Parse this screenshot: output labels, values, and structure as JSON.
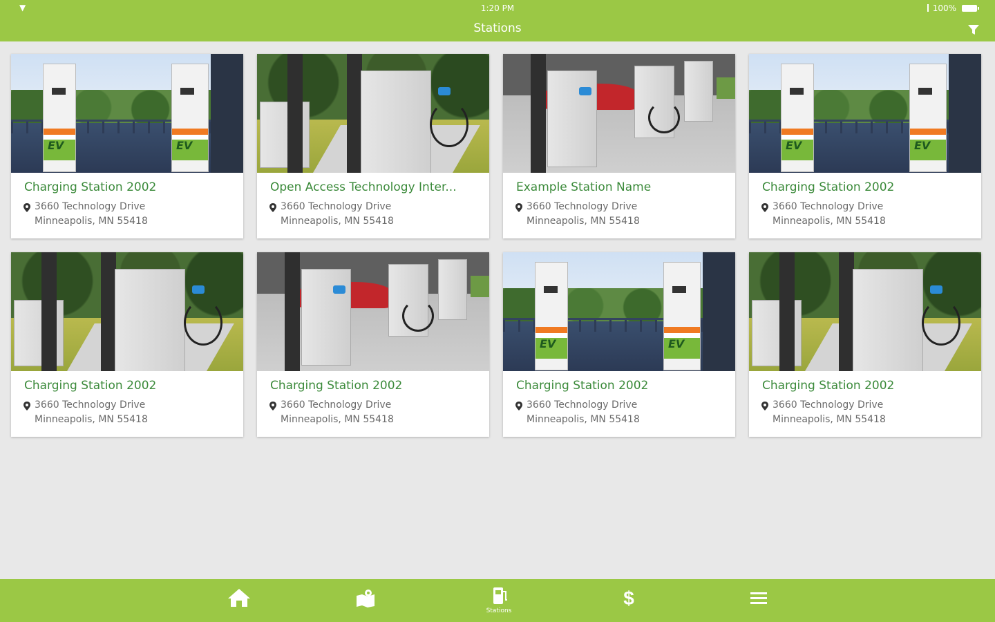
{
  "status_bar": {
    "time": "1:20 PM",
    "battery": "100%"
  },
  "app_bar": {
    "title": "Stations",
    "filter_icon": "filter-icon"
  },
  "stations": [
    {
      "name": "Charging Station 2002",
      "address_line1": "3660 Technology Drive",
      "address_line2": "Minneapolis, MN 55418",
      "photo": "ev-chargers-parking"
    },
    {
      "name": "Open Access Technology Inter...",
      "address_line1": "3660 Technology Drive",
      "address_line2": "Minneapolis, MN 55418",
      "photo": "charger-pole-grass"
    },
    {
      "name": "Example Station Name",
      "address_line1": "3660 Technology Drive",
      "address_line2": "Minneapolis, MN 55418",
      "photo": "chargers-row-lot"
    },
    {
      "name": "Charging Station 2002",
      "address_line1": "3660 Technology Drive",
      "address_line2": "Minneapolis, MN 55418",
      "photo": "ev-chargers-parking"
    },
    {
      "name": "Charging Station 2002",
      "address_line1": "3660 Technology Drive",
      "address_line2": "Minneapolis, MN 55418",
      "photo": "charger-pole-grass"
    },
    {
      "name": "Charging Station 2002",
      "address_line1": "3660 Technology Drive",
      "address_line2": "Minneapolis, MN 55418",
      "photo": "chargers-row-lot"
    },
    {
      "name": "Charging Station 2002",
      "address_line1": "3660 Technology Drive",
      "address_line2": "Minneapolis, MN 55418",
      "photo": "ev-chargers-parking"
    },
    {
      "name": "Charging Station 2002",
      "address_line1": "3660 Technology Drive",
      "address_line2": "Minneapolis, MN 55418",
      "photo": "charger-pole-grass"
    }
  ],
  "tab_bar": {
    "items": [
      {
        "icon": "home-icon",
        "label": ""
      },
      {
        "icon": "map-icon",
        "label": ""
      },
      {
        "icon": "station-icon",
        "label": "Stations"
      },
      {
        "icon": "dollar-icon",
        "label": ""
      },
      {
        "icon": "menu-icon",
        "label": ""
      }
    ]
  },
  "colors": {
    "accent": "#9bc845",
    "station_name": "#3b8a3a",
    "address_text": "#6a6a6a",
    "background": "#e8e8e8"
  }
}
